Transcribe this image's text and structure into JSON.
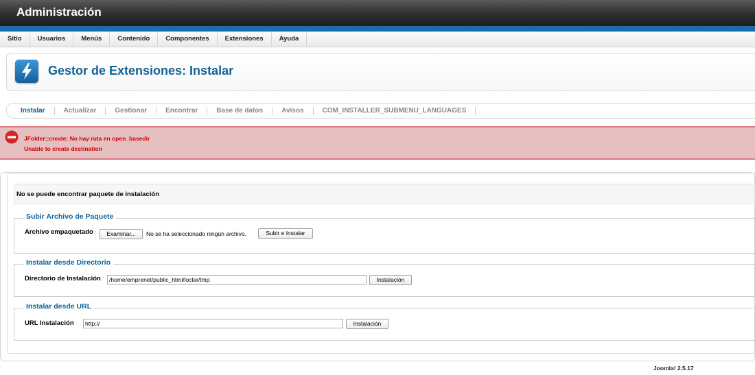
{
  "header": {
    "title": "Administración"
  },
  "menu": {
    "items": [
      "Sitio",
      "Usuarios",
      "Menús",
      "Contenido",
      "Componentes",
      "Extensiones",
      "Ayuda"
    ]
  },
  "page": {
    "title": "Gestor de Extensiones: Instalar",
    "icon": "lightning-bolt-icon"
  },
  "submenu": {
    "items": [
      "Instalar",
      "Actualizar",
      "Gestionar",
      "Encontrar",
      "Base de datos",
      "Avisos",
      "COM_INSTALLER_SUBMENU_LANGUAGES"
    ],
    "active": "Instalar"
  },
  "error": {
    "lines": [
      "JFolder::create: No hay ruta en open_basedir",
      "Unable to create destination"
    ],
    "color": "#cc0000"
  },
  "content": {
    "message": "No se puede encontrar paquete de instalación",
    "upload": {
      "legend": "Subir Archivo de Paquete",
      "label": "Archivo empaquetado",
      "browse_label": "Examinar...",
      "file_status": "No se ha seleccionado ningún archivo.",
      "submit_label": "Subir e Instalar"
    },
    "directory": {
      "legend": "Instalar desde Directorio",
      "label": "Directorio de Instalación",
      "value": "/home/emprenet/public_html/loclar/tmp",
      "submit_label": "Instalación"
    },
    "url": {
      "legend": "Instalar desde URL",
      "label": "URL Instalación",
      "value": "http://",
      "submit_label": "Instalación"
    }
  },
  "footer": {
    "version": "Joomla! 2.5.17"
  },
  "colors": {
    "accent": "#146295",
    "header_bar": "#1a6cae",
    "error_bg": "#e6c0c0"
  }
}
